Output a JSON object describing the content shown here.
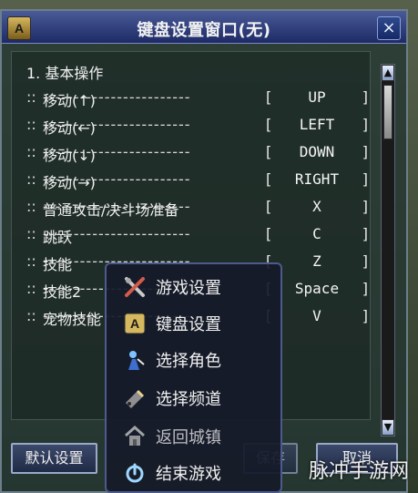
{
  "window": {
    "title": "键盘设置窗口(无)",
    "title_icon": "A",
    "close_glyph": "×"
  },
  "section_title": "1. 基本操作",
  "rows": [
    {
      "prefix": "::",
      "label": "移动(↑)",
      "lbr": "[",
      "key": "UP",
      "rbr": "]"
    },
    {
      "prefix": "::",
      "label": "移动(←)",
      "lbr": "[",
      "key": "LEFT",
      "rbr": "]"
    },
    {
      "prefix": "::",
      "label": "移动(↓)",
      "lbr": "[",
      "key": "DOWN",
      "rbr": "]"
    },
    {
      "prefix": "::",
      "label": "移动(→)",
      "lbr": "[",
      "key": "RIGHT",
      "rbr": "]"
    },
    {
      "prefix": "::",
      "label": "普通攻击/决斗场准备",
      "lbr": "[",
      "key": "X",
      "rbr": "]"
    },
    {
      "prefix": "::",
      "label": "跳跃",
      "lbr": "[",
      "key": "C",
      "rbr": "]"
    },
    {
      "prefix": "::",
      "label": "技能",
      "lbr": "[",
      "key": "Z",
      "rbr": "]"
    },
    {
      "prefix": "::",
      "label": "技能2",
      "lbr": "[",
      "key": "Space",
      "rbr": "]"
    },
    {
      "prefix": "::",
      "label": "宠物技能",
      "lbr": "[",
      "key": "V",
      "rbr": "]"
    }
  ],
  "dashes": "------------------------",
  "bottom_buttons": {
    "default": "默认设置",
    "apply": "保存",
    "cancel": "取消"
  },
  "popup_menu": [
    {
      "icon": "tools-icon",
      "label": "游戏设置"
    },
    {
      "icon": "keyboard-a-icon",
      "label": "键盘设置"
    },
    {
      "icon": "character-select-icon",
      "label": "选择角色"
    },
    {
      "icon": "channel-select-icon",
      "label": "选择频道"
    },
    {
      "icon": "home-icon",
      "label": "返回城镇"
    },
    {
      "icon": "power-icon",
      "label": "结束游戏"
    }
  ],
  "watermark": "脉冲手游网",
  "colors": {
    "titlebar_top": "#4a5b98",
    "titlebar_bottom": "#1d2a66",
    "window_border": "#6c7f8a",
    "popup_border": "#4c5a8d",
    "text": "#f0f0f0"
  }
}
